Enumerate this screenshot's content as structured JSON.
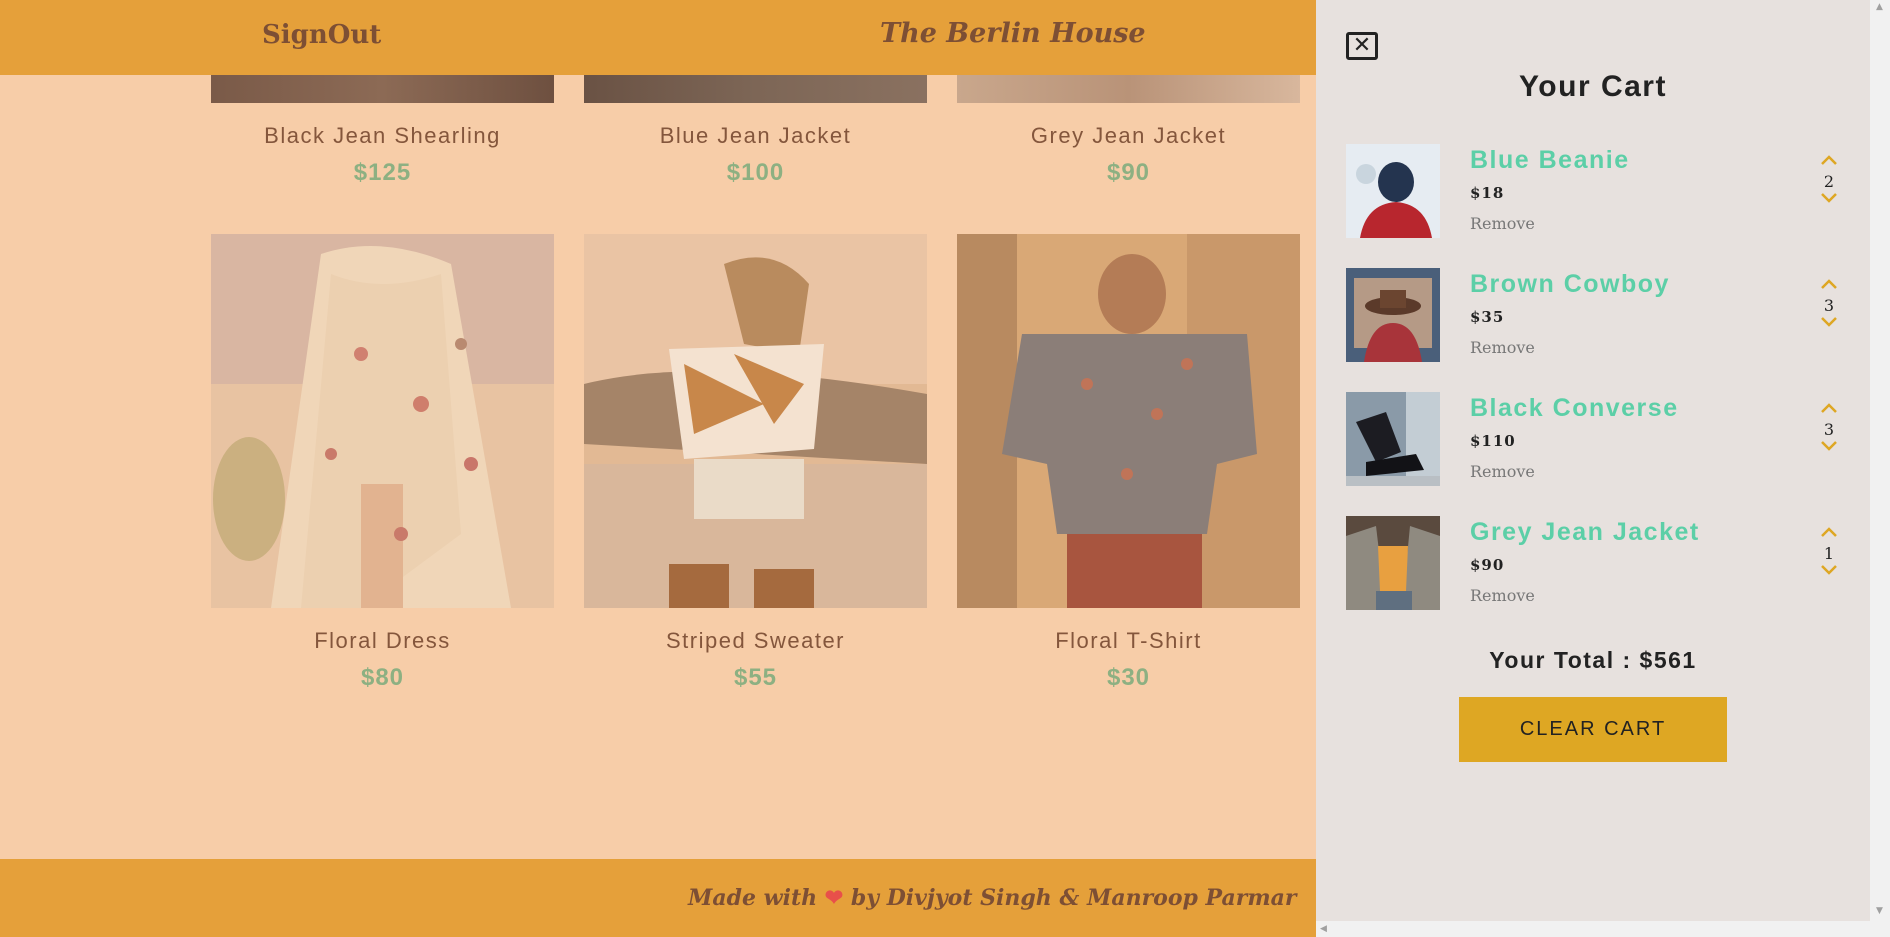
{
  "navbar": {
    "signout_label": "SignOut",
    "brand": "The Berlin House"
  },
  "products_top": [
    {
      "name": "Black Jean Shearling",
      "price": "$125"
    },
    {
      "name": "Blue Jean Jacket",
      "price": "$100"
    },
    {
      "name": "Grey Jean Jacket",
      "price": "$90"
    }
  ],
  "products": [
    {
      "name": "Floral Dress",
      "price": "$80"
    },
    {
      "name": "Striped Sweater",
      "price": "$55"
    },
    {
      "name": "Floral T-Shirt",
      "price": "$30"
    }
  ],
  "footer": {
    "made_with": "Made with",
    "by": "by Divjyot Singh & Manroop Parmar",
    "heart": "❤"
  },
  "cart": {
    "close_icon": "✕",
    "title": "Your Cart",
    "items": [
      {
        "name": "Blue Beanie",
        "price": "$18",
        "remove": "Remove",
        "qty": "2"
      },
      {
        "name": "Brown Cowboy",
        "price": "$35",
        "remove": "Remove",
        "qty": "3"
      },
      {
        "name": "Black Converse",
        "price": "$110",
        "remove": "Remove",
        "qty": "3"
      },
      {
        "name": "Grey Jean Jacket",
        "price": "$90",
        "remove": "Remove",
        "qty": "1"
      }
    ],
    "total": "Your Total : $561",
    "clear_label": "CLEAR CART"
  },
  "colors": {
    "accent": "#e5a03a",
    "overlay": "#f7cda8",
    "name_teal": "#5ccfa7",
    "button": "#dea723"
  }
}
